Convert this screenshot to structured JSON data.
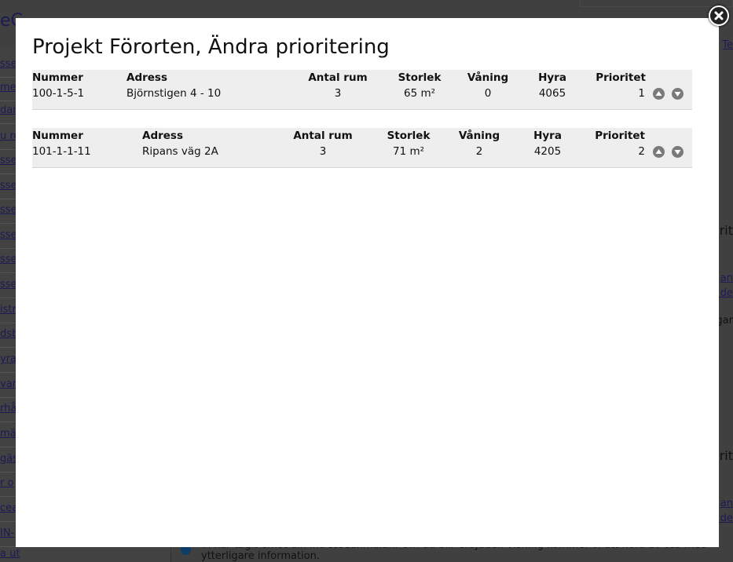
{
  "modal": {
    "title": "Projekt Förorten, Ändra prioritering",
    "close_icon": "close-icon",
    "columns": [
      "Nummer",
      "Adress",
      "Antal rum",
      "Storlek",
      "Våning",
      "Hyra",
      "Prioritet"
    ],
    "rows": [
      {
        "nummer": "100-1-5-1",
        "adress": "Björnstigen 4 - 10",
        "antal_rum": "3",
        "storlek": "65 m²",
        "vaning": "0",
        "hyra": "4065",
        "prioritet": "1"
      },
      {
        "nummer": "101-1-1-11",
        "adress": "Ripans väg 2A",
        "antal_rum": "3",
        "storlek": "71 m²",
        "vaning": "2",
        "hyra": "4205",
        "prioritet": "2"
      }
    ],
    "up_icon": "arrow-up-icon",
    "down_icon": "arrow-down-icon"
  },
  "background": {
    "header_fragment": "eC",
    "left_links": [
      "sse",
      "men",
      "dan",
      "u re",
      "sse.",
      "sse.",
      "sse.",
      "sse.",
      "sse.",
      "sse.",
      "istr",
      "dsb",
      "yra",
      "var",
      "rhål",
      "mäl",
      "gäs",
      "r o",
      "cea",
      "IN-",
      "a ut"
    ],
    "right_fragments": [
      "Te",
      "rit",
      "an",
      "i de",
      "gar",
      "rit",
      "an",
      "i de"
    ],
    "info_text": "Vi har tagit emot din intresseanmälan. Om du blir erbjuden visning kommer vi att höra av oss med ytterligare information."
  },
  "colors": {
    "overlay": "#404040",
    "modal": "#ffffff",
    "table_bg": "#eeeeee",
    "arrow": "#7a7a7a"
  }
}
